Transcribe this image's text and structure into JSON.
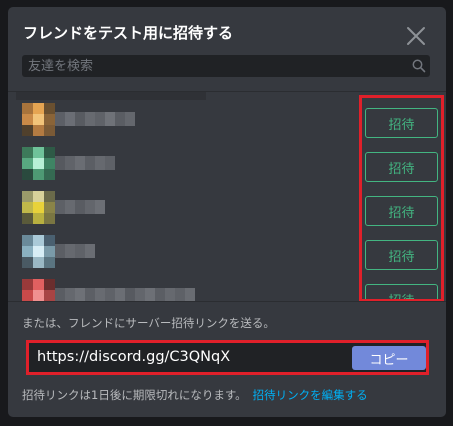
{
  "modal": {
    "title": "フレンドをテスト用に招待する",
    "search": {
      "placeholder": "友達を検索"
    },
    "invite_label": "招待",
    "friends": [
      {
        "avatar_colors": [
          "#a8743c",
          "#e6a552",
          "#6a5030",
          "#c98a48",
          "#f2c47a",
          "#8a6438",
          "#50402c",
          "#b37b42",
          "#7a5a36"
        ]
      },
      {
        "avatar_colors": [
          "#3d7a5a",
          "#6fc39a",
          "#2e5a46",
          "#58a880",
          "#b8f0d6",
          "#3f8464",
          "#2a4a3e",
          "#4e9a74",
          "#356a52"
        ]
      },
      {
        "avatar_colors": [
          "#9a9a6a",
          "#d8d29a",
          "#6a6a4a",
          "#c0b84a",
          "#e8d23a",
          "#8a8448",
          "#5a5a3a",
          "#b8b040",
          "#7a7642"
        ]
      },
      {
        "avatar_colors": [
          "#6a8a9a",
          "#aacad8",
          "#4a6070",
          "#8ab0c0",
          "#d8eef6",
          "#7a9aa8",
          "#4a5a64",
          "#9ab8c4",
          "#5a7480"
        ]
      },
      {
        "avatar_colors": [
          "#9a3a3a",
          "#e06060",
          "#6a2e2e",
          "#c84a4a",
          "#f09090",
          "#a84444",
          "#5a2a2a",
          "#b84848",
          "#7a3434"
        ]
      }
    ],
    "divider_text": "または、フレンドにサーバー招待リンクを送る。",
    "invite_link": "https://discord.gg/C3QNqX",
    "copy_label": "コピー",
    "expire_text": "招待リンクは1日後に期限切れになります。",
    "edit_link_label": "招待リンクを編集する",
    "colors": {
      "background": "#36393f",
      "accent_green": "#43b581",
      "blurple": "#7289da",
      "highlight_red": "#e0202a",
      "link_blue": "#00b0f4"
    }
  }
}
